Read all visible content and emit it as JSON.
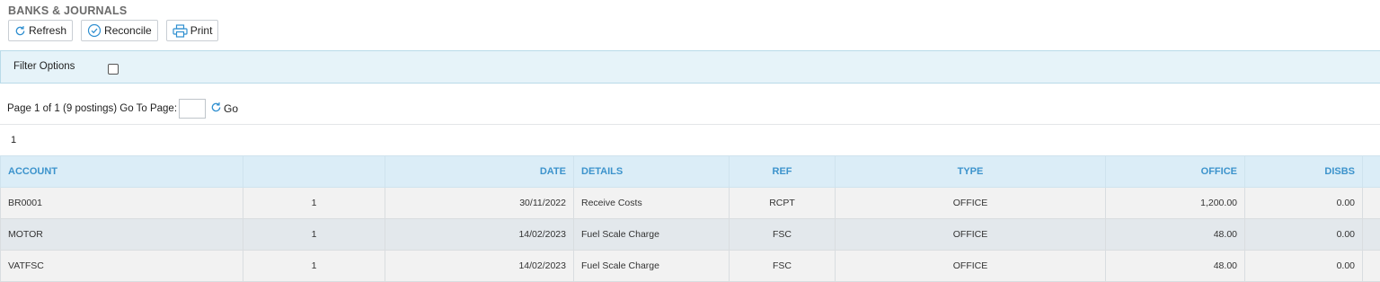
{
  "page": {
    "title": "BANKS & JOURNALS"
  },
  "toolbar": {
    "refresh_label": "Refresh",
    "reconcile_label": "Reconcile",
    "print_label": "Print"
  },
  "filter": {
    "label": "Filter Options",
    "checked": false
  },
  "pager": {
    "text": "Page 1 of 1 (9 postings) Go To Page:",
    "go_label": "Go",
    "pages": "1"
  },
  "table": {
    "columns": [
      "ACCOUNT",
      "",
      "DATE",
      "DETAILS",
      "REF",
      "TYPE",
      "OFFICE",
      "DISBS",
      ""
    ],
    "rows": [
      {
        "account": "BR0001",
        "qty": "1",
        "date": "30/11/2022",
        "details": "Receive Costs",
        "ref": "RCPT",
        "type": "OFFICE",
        "office": "1,200.00",
        "disbs": "0.00"
      },
      {
        "account": "MOTOR",
        "qty": "1",
        "date": "14/02/2023",
        "details": "Fuel Scale Charge",
        "ref": "FSC",
        "type": "OFFICE",
        "office": "48.00",
        "disbs": "0.00"
      },
      {
        "account": "VATFSC",
        "qty": "1",
        "date": "14/02/2023",
        "details": "Fuel Scale Charge",
        "ref": "FSC",
        "type": "OFFICE",
        "office": "48.00",
        "disbs": "0.00"
      }
    ]
  },
  "colors": {
    "header_text": "#3c93cc",
    "negative": "#e0302f",
    "filter_bg": "#e6f3f9"
  },
  "icons": {
    "refresh": "refresh-icon",
    "reconcile": "check-circle-icon",
    "print": "printer-icon"
  }
}
